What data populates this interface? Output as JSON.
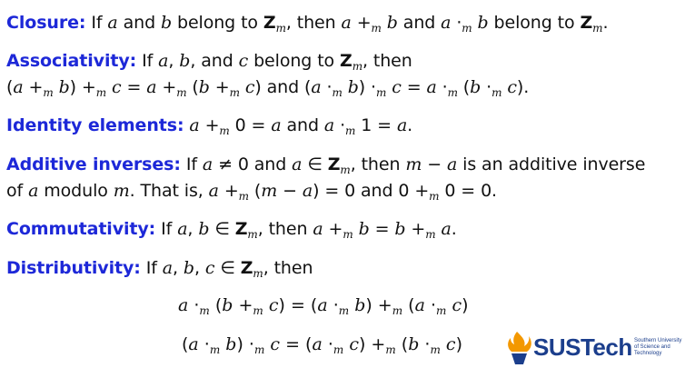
{
  "closure": {
    "label": "Closure:",
    "text": "If a and b belong to Zm, then a +m b and a ·m b belong to Zm."
  },
  "associativity": {
    "label": "Associativity:",
    "line1": "If a, b, and c belong to Zm, then",
    "line2": "(a +m b) +m c = a +m (b +m c) and (a ·m b) ·m c = a ·m (b ·m c)."
  },
  "identity": {
    "label": "Identity elements:",
    "text": "a +m 0 = a and a ·m 1 = a."
  },
  "additive_inverses": {
    "label": "Additive inverses:",
    "line1": "If a ≠ 0 and a ∈ Zm, then m − a is an additive inverse",
    "line2": "of a modulo m. That is, a +m (m − a) = 0 and 0 +m 0 = 0."
  },
  "commutativity": {
    "label": "Commutativity:",
    "text": "If a, b ∈ Zm, then a +m b = b +m a."
  },
  "distributivity": {
    "label": "Distributivity:",
    "text": "If a, b, c ∈ Zm, then",
    "eq1": "a ·m (b +m c) = (a ·m b) +m (a ·m c)",
    "eq2": "(a ·m b) ·m c = (a ·m c) +m (b ·m c)"
  },
  "logo": {
    "name": "SUSTech",
    "subtitle": "Southern University\nof Science and\nTechnology",
    "icon": "torch-flame-icon",
    "colors": {
      "flame": "#f39800",
      "text": "#1b3e8c"
    }
  },
  "colors": {
    "term": "#1d28d8",
    "text": "#111111"
  }
}
